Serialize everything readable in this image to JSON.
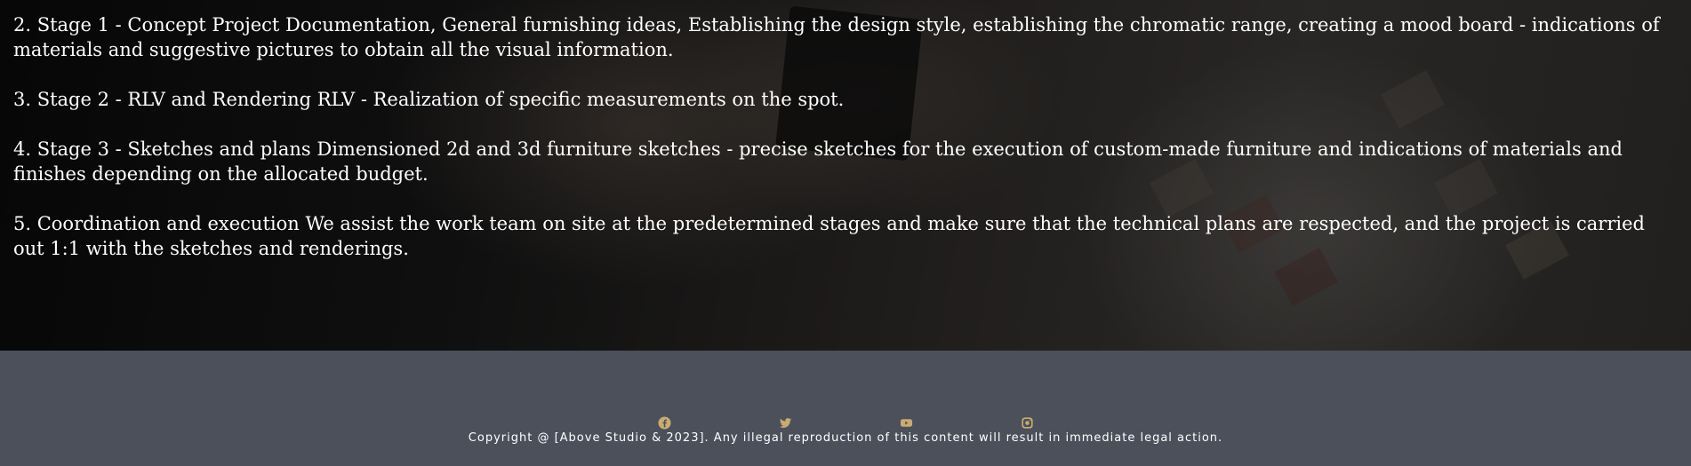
{
  "content": {
    "paragraphs": [
      "2. Stage 1 - Concept Project Documentation, General furnishing ideas, Establishing the design style, establishing the chromatic range, creating a mood board - indications of materials and suggestive pictures to obtain all the visual information.",
      "3. Stage 2 - RLV and Rendering RLV - Realization of specific measurements on the spot.",
      "4. Stage 3 - Sketches and plans Dimensioned 2d and 3d furniture sketches - precise sketches for the execution of custom-made furniture and indications of materials and finishes depending on the allocated budget.",
      "5. Coordination and execution We assist the work team on site at the predetermined stages and make sure that the technical plans are respected, and the project is carried out 1:1 with the sketches and renderings."
    ]
  },
  "footer": {
    "background": "#4b505b",
    "icon_color": "#c9ab72",
    "socials": [
      {
        "name": "facebook",
        "icon": "facebook-icon"
      },
      {
        "name": "twitter",
        "icon": "twitter-icon"
      },
      {
        "name": "youtube",
        "icon": "youtube-icon"
      },
      {
        "name": "instagram",
        "icon": "instagram-icon"
      }
    ],
    "copyright": "Copyright @ [Above Studio & 2023]. Any illegal reproduction of this content will result in immediate legal action."
  }
}
